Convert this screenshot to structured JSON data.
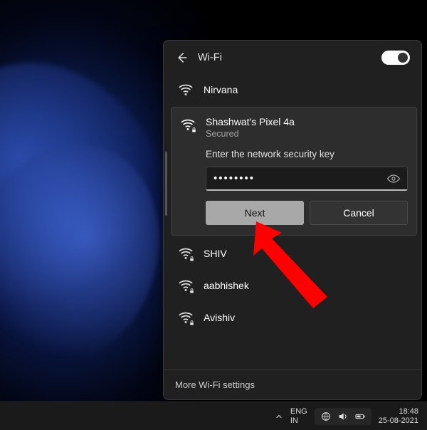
{
  "header": {
    "title": "Wi-Fi",
    "toggle_on": true
  },
  "prompt": "Enter the network security key",
  "password_value": "••••••••",
  "buttons": {
    "next": "Next",
    "cancel": "Cancel"
  },
  "networks": {
    "above": {
      "name": "Nirvana",
      "secured": false
    },
    "selected": {
      "name": "Shashwat's Pixel 4a",
      "sub": "Secured",
      "secured": true
    },
    "below": [
      {
        "name": "SHIV",
        "secured": true
      },
      {
        "name": "aabhishek",
        "secured": true
      },
      {
        "name": "Avishiv",
        "secured": true
      }
    ]
  },
  "footer_link": "More Wi-Fi settings",
  "taskbar": {
    "lang_top": "ENG",
    "lang_bottom": "IN",
    "time": "18:48",
    "date": "25-08-2021"
  }
}
